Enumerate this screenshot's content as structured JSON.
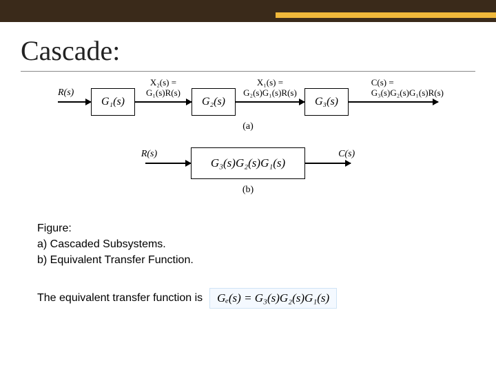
{
  "title": "Cascade:",
  "diagram_a": {
    "input": "R(s)",
    "sig1_top": "X₂(s) =",
    "sig1_bot": "G₁(s)R(s)",
    "sig2_top": "X₁(s) =",
    "sig2_bot": "G₂(s)G₁(s)R(s)",
    "out_top": "C(s) =",
    "out_bot": "G₃(s)G₂(s)G₁(s)R(s)",
    "g1": "G₁(s)",
    "g2": "G₂(s)",
    "g3": "G₃(s)",
    "label": "(a)"
  },
  "diagram_b": {
    "input": "R(s)",
    "output": "C(s)",
    "block": "G₃(s)G₂(s)G₁(s)",
    "label": "(b)"
  },
  "caption": {
    "l1": "Figure:",
    "l2": "a) Cascaded Subsystems.",
    "l3": "b) Equivalent Transfer Function."
  },
  "eq": {
    "lead": "The equivalent transfer function is",
    "formula": "Gₑ(s) = G₃(s)G₂(s)G₁(s)"
  }
}
